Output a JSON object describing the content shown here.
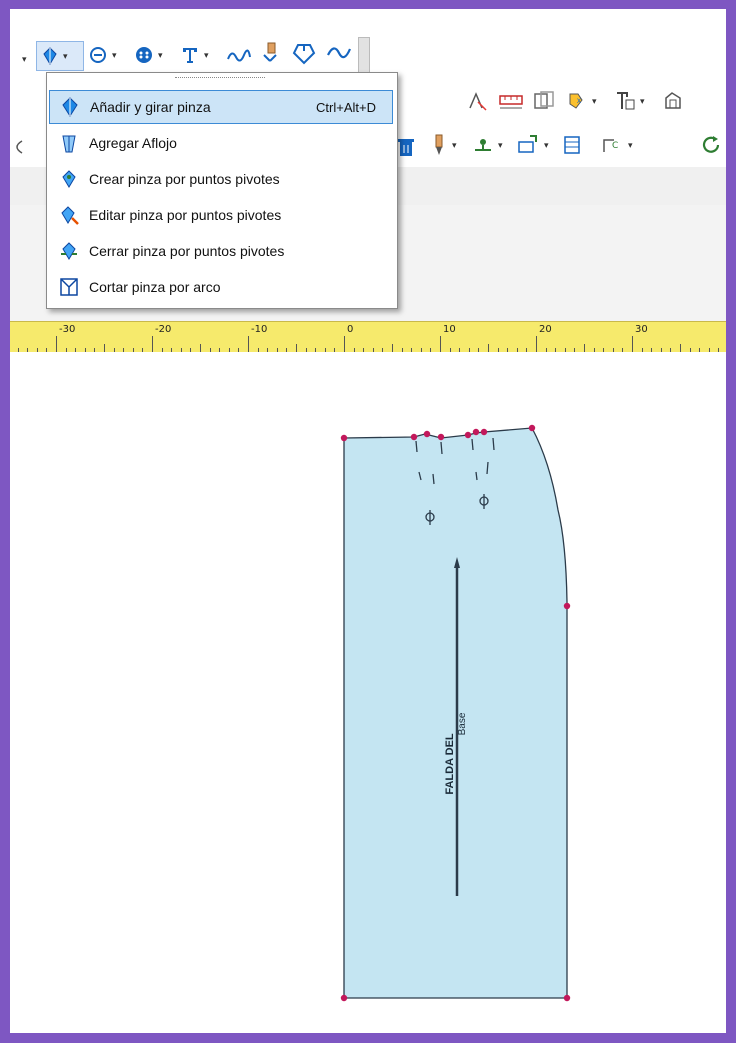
{
  "toolbar": {
    "row1": [
      "dart-tool-icon",
      "circle-tool-icon",
      "button-tool-icon",
      "text-tool-icon",
      "seam-tool-icon",
      "pin-tool-icon",
      "notch-tool-icon",
      "curve-tool-icon"
    ],
    "row2": [
      "pattern-icon",
      "measure-icon",
      "grading-icon",
      "copy-icon",
      "text-block-icon",
      "piece-icon"
    ],
    "row3": [
      "delete-icon",
      "marker-icon",
      "node-icon",
      "align-icon",
      "grid-icon",
      "rotate-icon",
      "refresh-icon"
    ]
  },
  "menu": {
    "items": [
      {
        "label": "Añadir y girar pinza",
        "shortcut": "Ctrl+Alt+D",
        "icon": "add-rotate-dart-icon",
        "highlighted": true
      },
      {
        "label": "Agregar Aflojo",
        "shortcut": "",
        "icon": "add-ease-icon",
        "highlighted": false
      },
      {
        "label": "Crear pinza por puntos pivotes",
        "shortcut": "",
        "icon": "create-pivot-dart-icon",
        "highlighted": false
      },
      {
        "label": "Editar pinza por puntos pivotes",
        "shortcut": "",
        "icon": "edit-pivot-dart-icon",
        "highlighted": false
      },
      {
        "label": "Cerrar pinza por puntos pivotes",
        "shortcut": "",
        "icon": "close-pivot-dart-icon",
        "highlighted": false
      },
      {
        "label": "Cortar pinza por arco",
        "shortcut": "",
        "icon": "cut-arc-dart-icon",
        "highlighted": false
      }
    ]
  },
  "ruler": {
    "labels": [
      "-30",
      "-20",
      "-10",
      "0",
      "10",
      "20",
      "30"
    ]
  },
  "pattern_piece": {
    "name": "FALDA DEL",
    "subname": "Base",
    "fill": "#c4e5f2",
    "stroke": "#2b3b4a",
    "point_color": "#c2185b"
  }
}
